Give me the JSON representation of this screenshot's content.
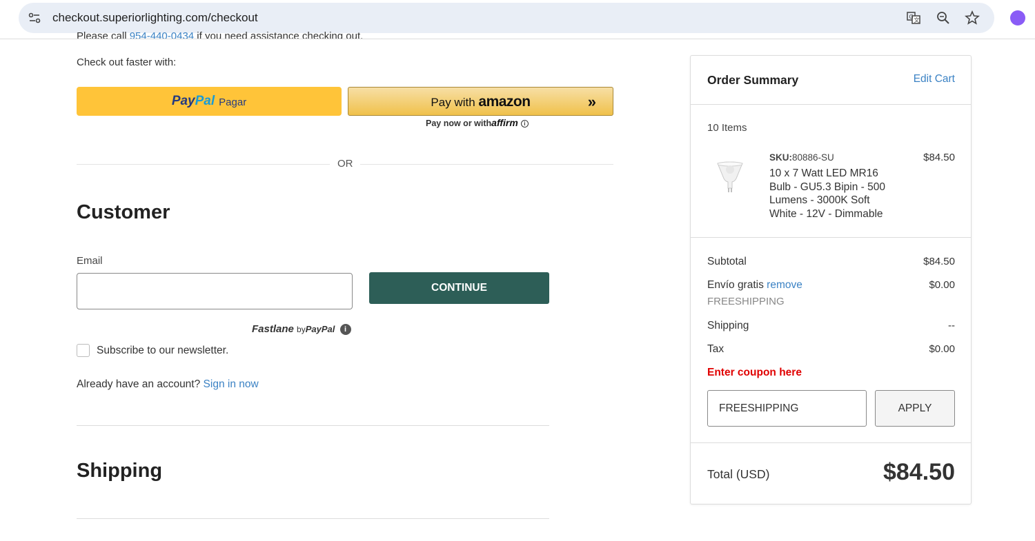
{
  "browser": {
    "url": "checkout.superiorlighting.com/checkout",
    "icons": [
      "site-info-icon",
      "translate-icon",
      "zoom-icon",
      "bookmark-star-icon",
      "profile-icon"
    ]
  },
  "checkout": {
    "assist_text_start": "Please call ",
    "assist_phone": "954-440-0434",
    "assist_text_end": " if you need assistance checking out.",
    "faster_label": "Check out faster with:",
    "paypal_logo_pay": "Pay",
    "paypal_logo_pal": "Pal",
    "paypal_label": "Pagar",
    "amazon_prefix": "Pay with ",
    "amazon_brand": "amazon",
    "amazon_arrow": "»",
    "affirm_prefix": "Pay now or with",
    "affirm_brand": "affirm",
    "or_text": "OR"
  },
  "customer": {
    "title": "Customer",
    "email_label": "Email",
    "email_value": "",
    "continue_label": "CONTINUE",
    "fastlane_brand": "Fastlane",
    "fastlane_by": "by",
    "fastlane_paypal": "PayPal",
    "fastlane_info": "i",
    "newsletter_label": "Subscribe to our newsletter.",
    "newsletter_checked": false,
    "account_question": "Already have an account?",
    "sign_in_label": "Sign in now"
  },
  "shipping": {
    "title": "Shipping"
  },
  "summary": {
    "title": "Order Summary",
    "edit_cart": "Edit Cart",
    "items_count": "10 Items",
    "item": {
      "sku_label": "SKU:",
      "sku": "80886-SU",
      "name": "10 x 7 Watt LED MR16 Bulb - GU5.3 Bipin - 500 Lumens - 3000K Soft White - 12V - Dimmable",
      "price": "$84.50"
    },
    "subtotal_label": "Subtotal",
    "subtotal_value": "$84.50",
    "free_shipping_label": "Envío gratis",
    "remove_label": "remove",
    "free_shipping_value": "$0.00",
    "coupon_code_applied": "FREESHIPPING",
    "shipping_label": "Shipping",
    "shipping_value": "--",
    "tax_label": "Tax",
    "tax_value": "$0.00",
    "coupon_prompt": "Enter coupon here",
    "coupon_input_value": "FREESHIPPING",
    "apply_label": "APPLY",
    "total_label": "Total (USD)",
    "total_value": "$84.50"
  },
  "colors": {
    "accent_link": "#3b82c4",
    "continue_bg": "#2d5e57",
    "paypal_yellow": "#ffc439",
    "coupon_red": "#e00000"
  }
}
